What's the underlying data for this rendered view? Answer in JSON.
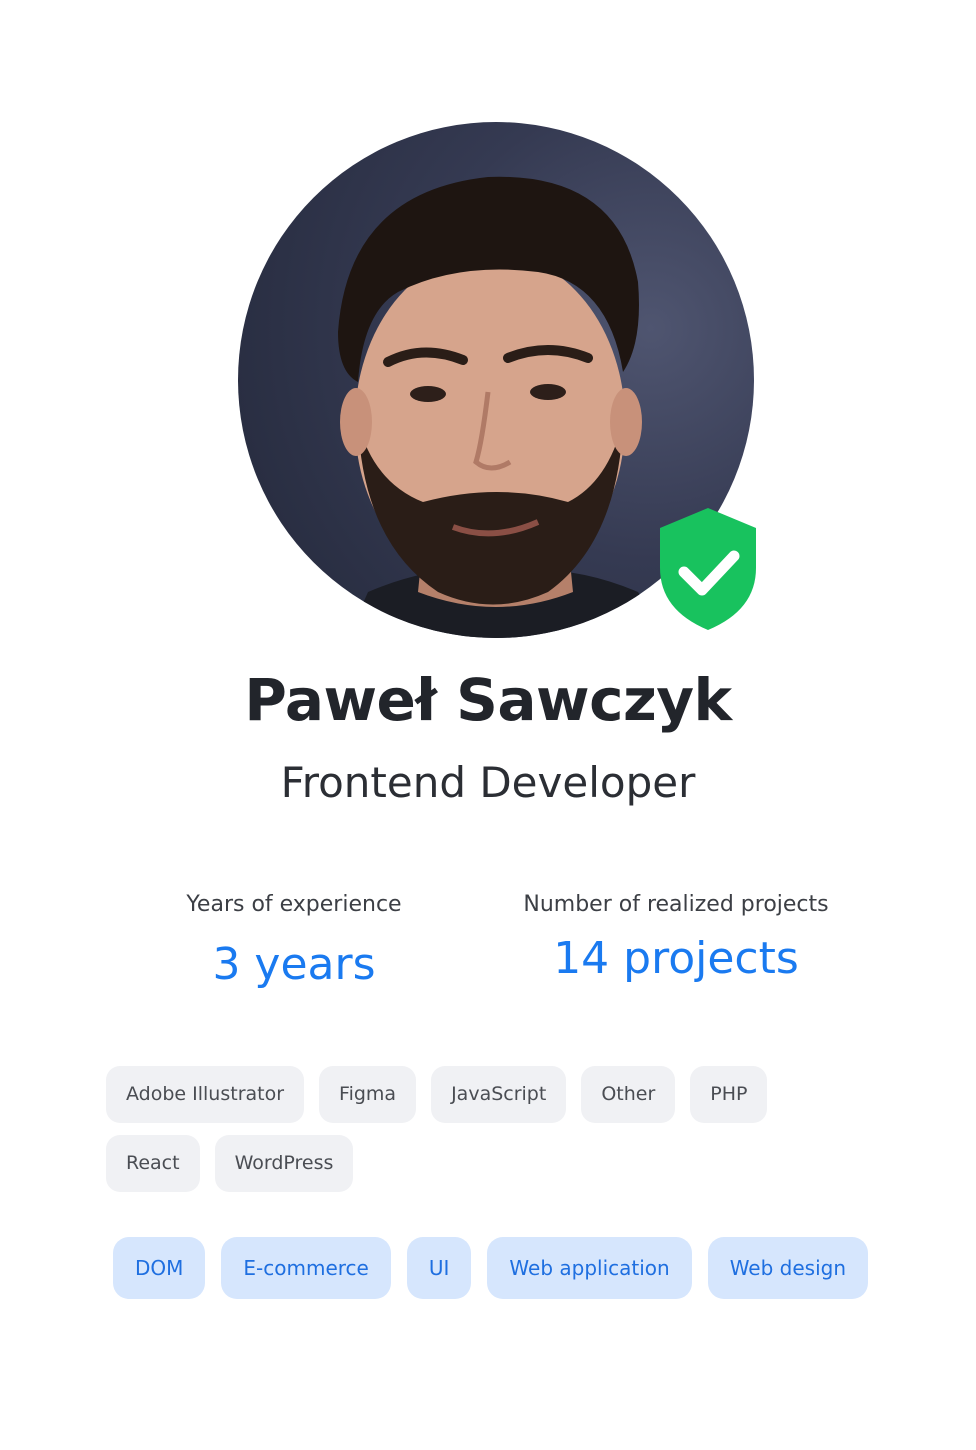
{
  "profile": {
    "name": "Paweł Sawczyk",
    "role": "Frontend Developer",
    "verified": true
  },
  "stats": {
    "experience": {
      "label": "Years of experience",
      "value": "3 years"
    },
    "projects": {
      "label": "Number of realized projects",
      "value": "14 projects"
    }
  },
  "skills": [
    "Adobe Illustrator",
    "Figma",
    "JavaScript",
    "Other",
    "PHP",
    "React",
    "WordPress"
  ],
  "specialties": [
    "DOM",
    "E-commerce",
    "UI",
    "Web application",
    "Web design"
  ],
  "colors": {
    "accent": "#1a7af0",
    "verified": "#18c25e",
    "tag_gray_bg": "#f0f1f4",
    "tag_blue_bg": "#d6e6fd"
  },
  "icons": {
    "badge": "shield-check-icon"
  }
}
